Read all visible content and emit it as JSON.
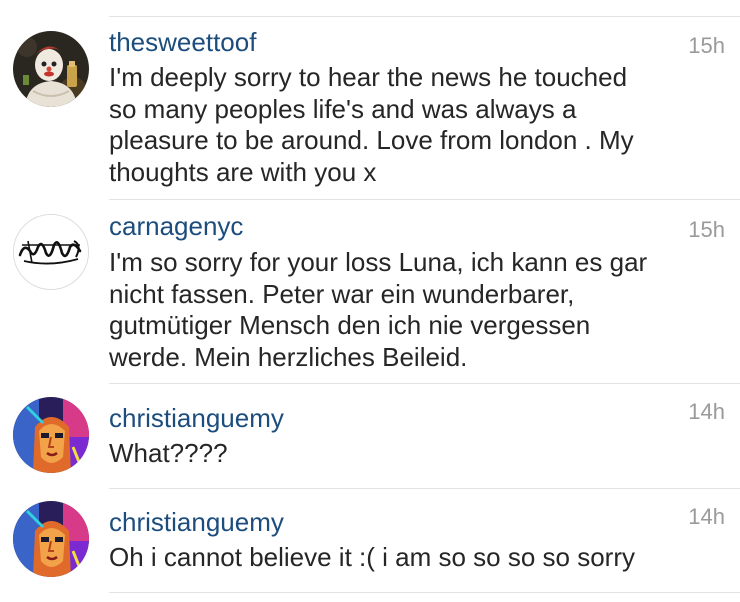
{
  "comments": [
    {
      "username": "thesweettoof",
      "time": "15h",
      "text": "I'm deeply sorry to hear the news he touched\nso many peoples life's and was always a\npleasure to be around. Love from london . My\nthoughts are with you x",
      "avatar": "clown-portrait-avatar"
    },
    {
      "username": "carnagenyc",
      "time": "15h",
      "text": "I'm so sorry for your loss Luna, ich kann es gar\nnicht fassen. Peter war ein wunderbarer,\ngutmütiger Mensch den ich nie vergessen\nwerde. Mein herzliches Beileid.",
      "avatar": "graffiti-tag-avatar"
    },
    {
      "username": "christianguemy",
      "time": "14h",
      "text": "What????",
      "avatar": "painted-face-avatar"
    },
    {
      "username": "christianguemy",
      "time": "14h",
      "text": "Oh i cannot believe it :( i am so so so so sorry",
      "avatar": "painted-face-avatar"
    }
  ],
  "colors": {
    "username": "#1c4d7c",
    "text": "#262626",
    "timestamp": "#9a9a9a",
    "divider": "#e3e3e3"
  }
}
